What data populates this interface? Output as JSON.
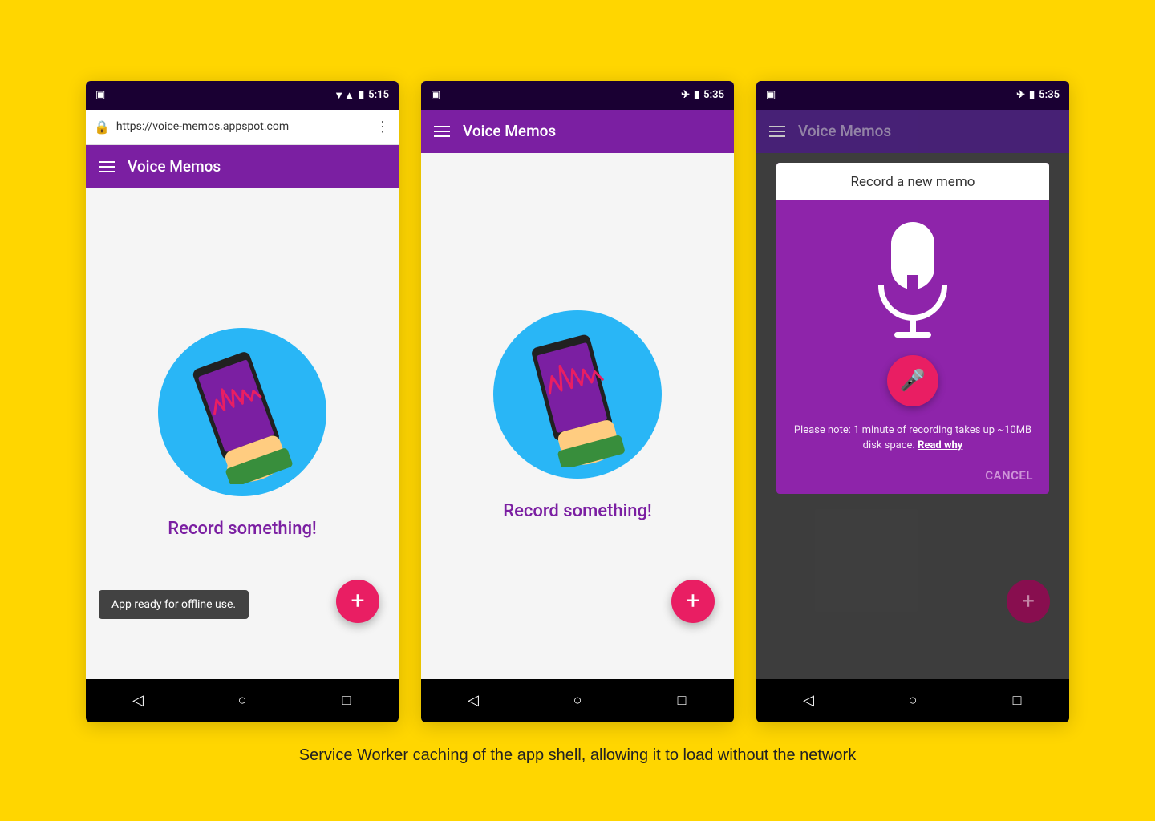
{
  "background_color": "#FFD600",
  "caption": "Service Worker caching of the app shell, allowing it to load without the network",
  "phones": [
    {
      "id": "phone1",
      "status_bar": {
        "left_icon": "sim-icon",
        "signal": "▼▲",
        "battery": "🔋",
        "time": "5:15"
      },
      "url_bar": {
        "url": "https://voice-memos.appspot.com",
        "show": true
      },
      "app_bar": {
        "title": "Voice Memos",
        "show_hamburger": true
      },
      "content": {
        "record_label": "Record something!",
        "show_illustration": true
      },
      "toast": "App ready for offline use.",
      "fab_label": "+"
    },
    {
      "id": "phone2",
      "status_bar": {
        "time": "5:35"
      },
      "url_bar": {
        "show": false
      },
      "app_bar": {
        "title": "Voice Memos",
        "show_hamburger": true
      },
      "content": {
        "record_label": "Record something!",
        "show_illustration": true
      },
      "toast": null,
      "fab_label": "+"
    },
    {
      "id": "phone3",
      "status_bar": {
        "time": "5:35"
      },
      "url_bar": {
        "show": false
      },
      "app_bar": {
        "title": "Voice Memos",
        "show_hamburger": true,
        "dimmed": true
      },
      "dialog": {
        "title": "Record a new memo",
        "note": "Please note: 1 minute of recording takes up ~10MB disk space.",
        "note_link": "Read why",
        "cancel_label": "CANCEL"
      },
      "fab_label": "+"
    }
  ]
}
